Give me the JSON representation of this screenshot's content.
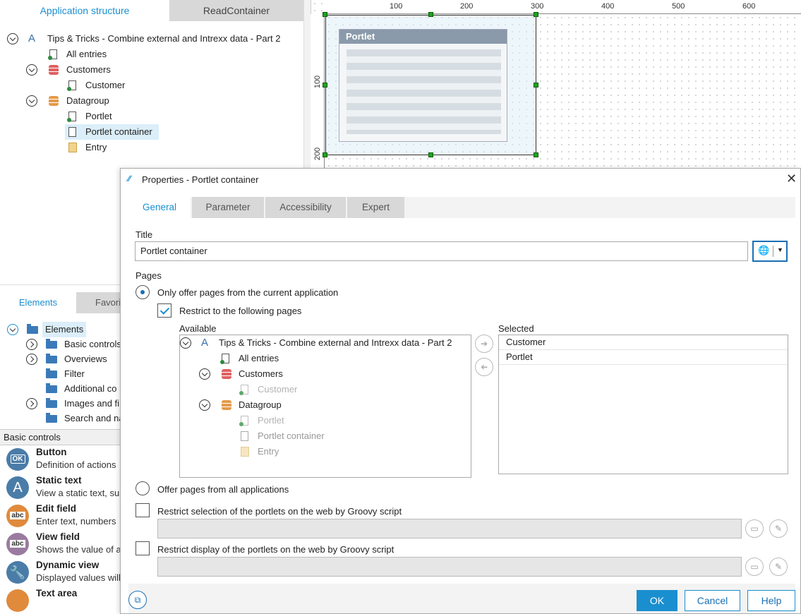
{
  "top_tabs": {
    "app_structure": "Application structure",
    "read_container": "ReadContainer"
  },
  "app_tree": {
    "root": "Tips & Tricks - Combine external and Intrexx data - Part 2",
    "all_entries": "All entries",
    "customers": "Customers",
    "customer": "Customer",
    "datagroup": "Datagroup",
    "portlet": "Portlet",
    "portlet_container": "Portlet container",
    "entry": "Entry"
  },
  "ruler": {
    "h": [
      "100",
      "200",
      "300",
      "400",
      "500",
      "600"
    ],
    "v": [
      "100",
      "200"
    ]
  },
  "canvas": {
    "portlet_title": "Portlet"
  },
  "elements_panel": {
    "tab_elements": "Elements",
    "tab_favorites": "Favori",
    "root": "Elements",
    "items": [
      "Basic controls",
      "Overviews",
      "Filter",
      "Additional co",
      "Images and fi",
      "Search and na"
    ]
  },
  "basic_controls": {
    "header": "Basic controls",
    "items": [
      {
        "title": "Button",
        "desc": "Definition of actions",
        "icon": "OK"
      },
      {
        "title": "Static text",
        "desc": "View a static text, su",
        "icon": "A"
      },
      {
        "title": "Edit field",
        "desc": "Enter text, numbers",
        "icon": "abc"
      },
      {
        "title": "View field",
        "desc": "Shows the value of a",
        "icon": "abc"
      },
      {
        "title": "Dynamic view",
        "desc": "Displayed values will",
        "icon": "wrench"
      },
      {
        "title": "Text area",
        "desc": "",
        "icon": "textarea"
      }
    ]
  },
  "dialog": {
    "title": "Properties - Portlet container",
    "tabs": [
      "General",
      "Parameter",
      "Accessibility",
      "Expert"
    ],
    "title_label": "Title",
    "title_value": "Portlet container",
    "pages_label": "Pages",
    "only_current": "Only offer pages from the current application",
    "restrict_following": "Restrict to the following pages",
    "available_label": "Available",
    "selected_label": "Selected",
    "available_tree": {
      "root": "Tips & Tricks - Combine external and Intrexx data - Part 2",
      "all_entries": "All entries",
      "customers": "Customers",
      "customer": "Customer",
      "datagroup": "Datagroup",
      "portlet": "Portlet",
      "portlet_container": "Portlet container",
      "entry": "Entry"
    },
    "selected_items": [
      "Customer",
      "Portlet"
    ],
    "all_apps": "Offer pages from all applications",
    "restrict_selection": "Restrict selection of the portlets on the web by Groovy script",
    "restrict_display": "Restrict display of the portlets on the web by Groovy script",
    "ok": "OK",
    "cancel": "Cancel",
    "help": "Help"
  }
}
